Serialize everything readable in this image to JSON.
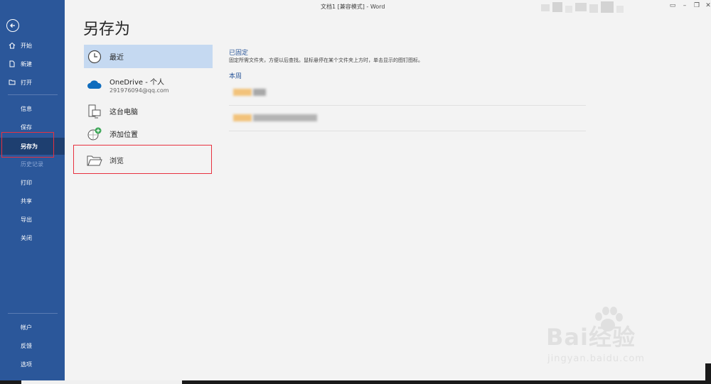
{
  "window": {
    "title": "文档1 [兼容模式]  -  Word"
  },
  "sidebar": {
    "top_items": [
      {
        "label": "开始",
        "icon": "home-icon"
      },
      {
        "label": "新建",
        "icon": "new-document-icon"
      },
      {
        "label": "打开",
        "icon": "open-folder-icon"
      }
    ],
    "middle_items": [
      {
        "label": "信息"
      },
      {
        "label": "保存"
      },
      {
        "label": "另存为"
      },
      {
        "label": "历史记录"
      },
      {
        "label": "打印"
      },
      {
        "label": "共享"
      },
      {
        "label": "导出"
      },
      {
        "label": "关闭"
      }
    ],
    "bottom_items": [
      {
        "label": "帐户"
      },
      {
        "label": "反馈"
      },
      {
        "label": "选项"
      }
    ]
  },
  "page": {
    "title": "另存为"
  },
  "locations": [
    {
      "label": "最近",
      "icon": "clock-icon"
    },
    {
      "label": "OneDrive - 个人",
      "sub": "291976094@qq.com",
      "icon": "onedrive-cloud-icon"
    },
    {
      "label": "这台电脑",
      "icon": "this-pc-icon"
    },
    {
      "label": "添加位置",
      "icon": "add-location-icon"
    },
    {
      "label": "浏览",
      "icon": "browse-folder-icon"
    }
  ],
  "right_pane": {
    "pinned_title": "已固定",
    "pinned_desc": "固定所需文件夹，方便以后查找。鼠标悬停在某个文件夹上方时，单击显示的图钉图标。",
    "week_title": "本周"
  },
  "watermark": {
    "brand": "Bai经验",
    "url": "jingyan.baidu.com"
  },
  "colors": {
    "sidebar": "#2b579a",
    "accent_text": "#2b579a",
    "selected_location": "#c5d9f1",
    "annotation_box": "#e8313f"
  }
}
